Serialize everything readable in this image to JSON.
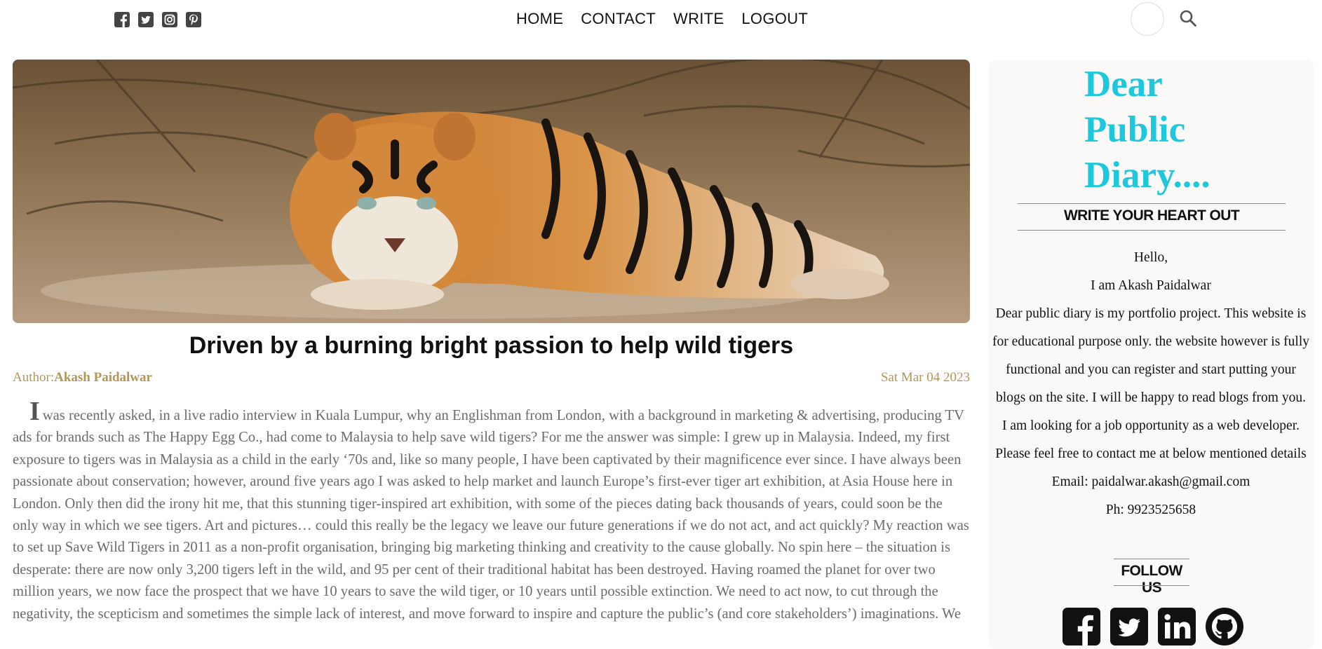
{
  "header": {
    "social": [
      {
        "icon": "facebook-square-icon"
      },
      {
        "icon": "twitter-square-icon"
      },
      {
        "icon": "instagram-square-icon"
      },
      {
        "icon": "pinterest-square-icon"
      }
    ],
    "nav": [
      {
        "label": "HOME"
      },
      {
        "label": "CONTACT"
      },
      {
        "label": "WRITE"
      },
      {
        "label": "LOGOUT"
      }
    ],
    "avatar_icon": "profile-avatar",
    "search_icon": "search-icon"
  },
  "post": {
    "title": "Driven by a burning bright passion to help wild tigers",
    "author_label": "Author:",
    "author_name": "Akash Paidalwar",
    "date": "Sat Mar 04 2023",
    "dropcap": "I",
    "body": "was recently asked, in a live radio interview in Kuala Lumpur, why an Englishman from London, with a background in marketing & advertising, producing TV ads for brands such as The Happy Egg Co., had come to Malaysia to help save wild tigers? For me the answer was simple: I grew up in Malaysia. Indeed, my first exposure to tigers was in Malaysia as a child in the early ‘70s and, like so many people, I have been captivated by their magnificence ever since. I have always been passionate about conservation; however, around five years ago I was asked to help market and launch Europe’s first-ever tiger art exhibition, at Asia House here in London. Only then did the irony hit me, that this stunning tiger-inspired art exhibition, with some of the pieces dating back thousands of years, could soon be the only way in which we see tigers. Art and pictures… could this really be the legacy we leave our future generations if we do not act, and act quickly? My reaction was to set up Save Wild Tigers in 2011 as a non-profit organisation, bringing big marketing thinking and creativity to the cause globally. No spin here – the situation is desperate: there are now only 3,200 tigers left in the wild, and 95 per cent of their traditional habitat has been destroyed. Having roamed the planet for over two million years, we now face the prospect that we have 10 years to save the wild tiger, or 10 years until possible extinction. We need to act now, to cut through the negativity, the scepticism and sometimes the simple lack of interest, and move forward to inspire and capture the public’s (and core stakeholders’) imaginations. We"
  },
  "sidebar": {
    "brand_lines": [
      "Dear",
      "Public",
      "Diary...."
    ],
    "tagline": "WRITE YOUR HEART OUT",
    "about": [
      "Hello,",
      "I am Akash Paidalwar",
      "Dear public diary is my portfolio project. This website is for educational purpose only. the website however is fully functional and you can register and start putting your blogs on the site. I will be happy to read blogs from you.",
      "I am looking for a job opportunity as a web developer.",
      "Please feel free to contact me at below mentioned details",
      "Email: paidalwar.akash@gmail.com",
      "Ph: 9923525658"
    ],
    "follow_title": "FOLLOW US",
    "follow_icons": [
      {
        "icon": "facebook-square-icon"
      },
      {
        "icon": "twitter-square-icon"
      },
      {
        "icon": "linkedin-square-icon"
      },
      {
        "icon": "github-icon"
      }
    ]
  },
  "colors": {
    "brand": "#1ec8dc",
    "meta": "#b39656",
    "body_text": "#6b6b6b"
  }
}
